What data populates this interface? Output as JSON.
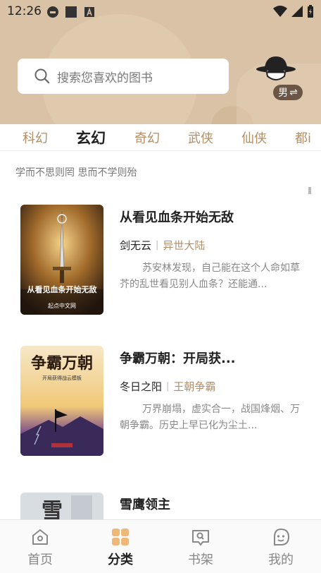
{
  "status_bar": {
    "time": "12:26"
  },
  "search": {
    "placeholder": "搜索您喜欢的图书"
  },
  "gender": {
    "label": "男",
    "switch_glyph": "⇌"
  },
  "tabs": [
    "科幻",
    "玄幻",
    "奇幻",
    "武侠",
    "仙侠",
    "都i"
  ],
  "active_tab_index": 1,
  "motto": "学而不思则罔 思而不学则殆",
  "books": [
    {
      "title": "从看见血条开始无敌",
      "author": "剑无云",
      "separator": "|",
      "genre": "异世大陆",
      "description": "苏安林发现，自己能在这个人命如草芥的乱世看见别人血条？还能通...",
      "cover_text": "从看见血条开始无敌",
      "cover_publisher": "起点中文网"
    },
    {
      "title": "争霸万朝：开局获...",
      "author": "冬日之阳",
      "separator": "|",
      "genre": "王朝争霸",
      "description": "万界崩塌，虚实合一，战国烽烟、万朝争霸。历史上早已化为尘土...",
      "cover_text": "争霸万朝",
      "cover_subtitle": "开局获得战云模板"
    },
    {
      "title": "雪鹰领主",
      "cover_text": "雪"
    }
  ],
  "bottom_nav": [
    {
      "label": "首页",
      "icon": "home-icon"
    },
    {
      "label": "分类",
      "icon": "category-icon"
    },
    {
      "label": "书架",
      "icon": "bookshelf-icon"
    },
    {
      "label": "我的",
      "icon": "profile-icon"
    }
  ],
  "colors": {
    "accent": "#b28e66",
    "header_bg": "#d9c2a5",
    "active_nav": "#f0b878"
  }
}
